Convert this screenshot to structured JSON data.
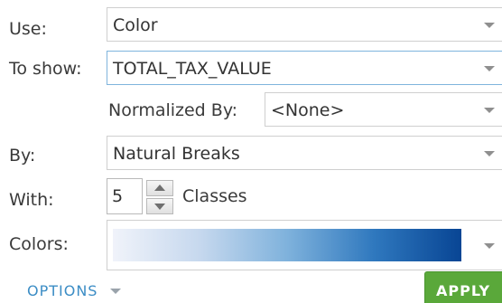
{
  "form": {
    "use": {
      "label": "Use:",
      "value": "Color"
    },
    "to_show": {
      "label": "To show:",
      "value": "TOTAL_TAX_VALUE"
    },
    "normalized_by": {
      "label": "Normalized By:",
      "value": "<None>"
    },
    "by": {
      "label": "By:",
      "value": "Natural Breaks"
    },
    "with": {
      "label": "With:",
      "value": "5",
      "unit": "Classes"
    },
    "colors": {
      "label": "Colors:",
      "ramp": [
        "#f0f3fa",
        "#c6d8ee",
        "#7fb2dc",
        "#2f78be",
        "#084594"
      ]
    }
  },
  "footer": {
    "options_label": "OPTIONS",
    "apply_label": "APPLY"
  },
  "theme": {
    "link_color": "#3c8dc5",
    "apply_color": "#5aa83a",
    "focus_border": "#7fb4dd",
    "icons": [
      "chevron-down-icon",
      "spin-up-icon",
      "spin-down-icon"
    ]
  }
}
